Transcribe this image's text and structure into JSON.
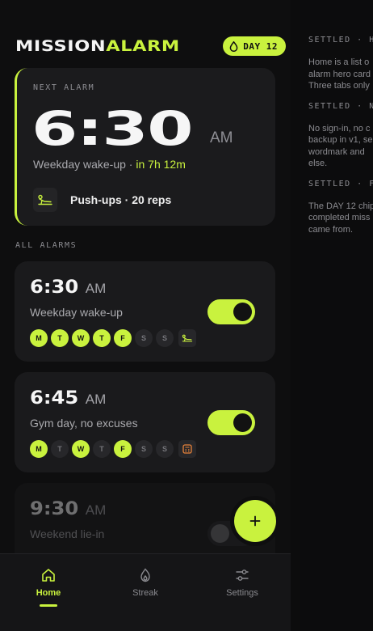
{
  "brand": {
    "word1": "MISSION",
    "word2": "ALARM"
  },
  "streak_chip": {
    "label": "DAY 12"
  },
  "next_alarm": {
    "label": "NEXT ALARM",
    "time": "6:30",
    "ampm": "AM",
    "name": "Weekday wake-up",
    "separator": " · ",
    "eta": "in 7h 12m",
    "mission": "Push-ups · 20 reps",
    "mission_icon": "pushup-icon"
  },
  "section_label": "ALL ALARMS",
  "alarms": [
    {
      "time": "6:30",
      "ampm": "AM",
      "label": "Weekday wake-up",
      "enabled": true,
      "days": [
        {
          "l": "M",
          "on": true
        },
        {
          "l": "T",
          "on": true
        },
        {
          "l": "W",
          "on": true
        },
        {
          "l": "T",
          "on": true
        },
        {
          "l": "F",
          "on": true
        },
        {
          "l": "S",
          "on": false
        },
        {
          "l": "S",
          "on": false
        }
      ],
      "mission_icon": "pushup-icon"
    },
    {
      "time": "6:45",
      "ampm": "AM",
      "label": "Gym day, no excuses",
      "enabled": true,
      "days": [
        {
          "l": "M",
          "on": true
        },
        {
          "l": "T",
          "on": false
        },
        {
          "l": "W",
          "on": true
        },
        {
          "l": "T",
          "on": false
        },
        {
          "l": "F",
          "on": true
        },
        {
          "l": "S",
          "on": false
        },
        {
          "l": "S",
          "on": false
        }
      ],
      "mission_icon": "calculator-icon"
    },
    {
      "time": "9:30",
      "ampm": "AM",
      "label": "Weekend lie-in",
      "enabled": false,
      "days": [],
      "mission_icon": ""
    }
  ],
  "fab": {
    "icon": "plus-icon"
  },
  "nav": [
    {
      "label": "Home",
      "icon": "home-icon",
      "active": true
    },
    {
      "label": "Streak",
      "icon": "flame-icon",
      "active": false
    },
    {
      "label": "Settings",
      "icon": "sliders-icon",
      "active": false
    }
  ],
  "notes": [
    {
      "heading": "SETTLED · HO",
      "lines": [
        "Home is a list o",
        "alarm hero card",
        "Three tabs only"
      ]
    },
    {
      "heading": "SETTLED · NO",
      "lines": [
        "No sign-in, no c",
        "backup in v1, se",
        "wordmark and",
        "else."
      ]
    },
    {
      "heading": "SETTLED · FO",
      "lines": [
        "The DAY 12 chip",
        "completed miss",
        "came from."
      ]
    }
  ],
  "colors": {
    "accent": "#c9f23e",
    "background": "#0e0e0f",
    "card": "#1a1a1c",
    "mission_orange": "#e8833a"
  }
}
